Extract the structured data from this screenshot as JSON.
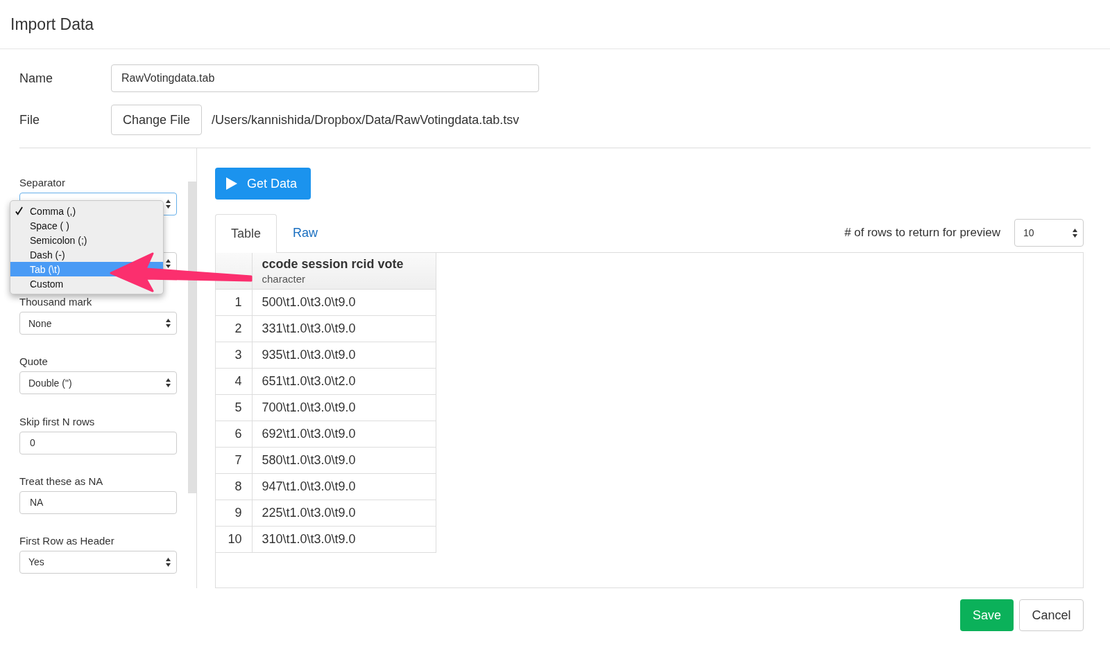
{
  "window": {
    "title": "Import Data"
  },
  "name_field": {
    "label": "Name",
    "value": "RawVotingdata.tab"
  },
  "file_field": {
    "label": "File",
    "button": "Change File",
    "path": "/Users/kannishida/Dropbox/Data/RawVotingdata.tab.tsv"
  },
  "options": [
    {
      "label": "Separator",
      "kind": "select",
      "open": true
    },
    {
      "kind": "select"
    },
    {
      "label": "Thousand mark",
      "kind": "select",
      "value": "None"
    },
    {
      "label": "Quote",
      "kind": "select",
      "value": "Double (\")"
    },
    {
      "label": "Skip first N rows",
      "kind": "input",
      "value": "0"
    },
    {
      "label": "Treat these as NA",
      "kind": "input",
      "value": "NA"
    },
    {
      "label": "First Row as Header",
      "kind": "select",
      "value": "Yes"
    }
  ],
  "separator_menu": [
    {
      "label": "Comma (,)",
      "checked": true,
      "selected": false
    },
    {
      "label": "Space ( )",
      "checked": false,
      "selected": false
    },
    {
      "label": "Semicolon (;)",
      "checked": false,
      "selected": false
    },
    {
      "label": "Dash (-)",
      "checked": false,
      "selected": false
    },
    {
      "label": "Tab (\\t)",
      "checked": false,
      "selected": true
    },
    {
      "label": "Custom",
      "checked": false,
      "selected": false
    }
  ],
  "get_data_button": "Get Data",
  "tabs": [
    {
      "label": "Table",
      "selected": true
    },
    {
      "label": "Raw",
      "selected": false
    }
  ],
  "preview_rows": {
    "label": "# of rows to return for preview",
    "value": "10"
  },
  "table": {
    "columns": [
      {
        "name": "ccode session rcid vote",
        "type": "character"
      }
    ],
    "rows": [
      {
        "index": "1",
        "cells": [
          "500\\t1.0\\t3.0\\t9.0"
        ]
      },
      {
        "index": "2",
        "cells": [
          "331\\t1.0\\t3.0\\t9.0"
        ]
      },
      {
        "index": "3",
        "cells": [
          "935\\t1.0\\t3.0\\t9.0"
        ]
      },
      {
        "index": "4",
        "cells": [
          "651\\t1.0\\t3.0\\t2.0"
        ]
      },
      {
        "index": "5",
        "cells": [
          "700\\t1.0\\t3.0\\t9.0"
        ]
      },
      {
        "index": "6",
        "cells": [
          "692\\t1.0\\t3.0\\t9.0"
        ]
      },
      {
        "index": "7",
        "cells": [
          "580\\t1.0\\t3.0\\t9.0"
        ]
      },
      {
        "index": "8",
        "cells": [
          "947\\t1.0\\t3.0\\t9.0"
        ]
      },
      {
        "index": "9",
        "cells": [
          "225\\t1.0\\t3.0\\t9.0"
        ]
      },
      {
        "index": "10",
        "cells": [
          "310\\t1.0\\t3.0\\t9.0"
        ]
      }
    ]
  },
  "footer_buttons": [
    {
      "label": "Save",
      "kind": "primary"
    },
    {
      "label": "Cancel",
      "kind": "default"
    }
  ]
}
